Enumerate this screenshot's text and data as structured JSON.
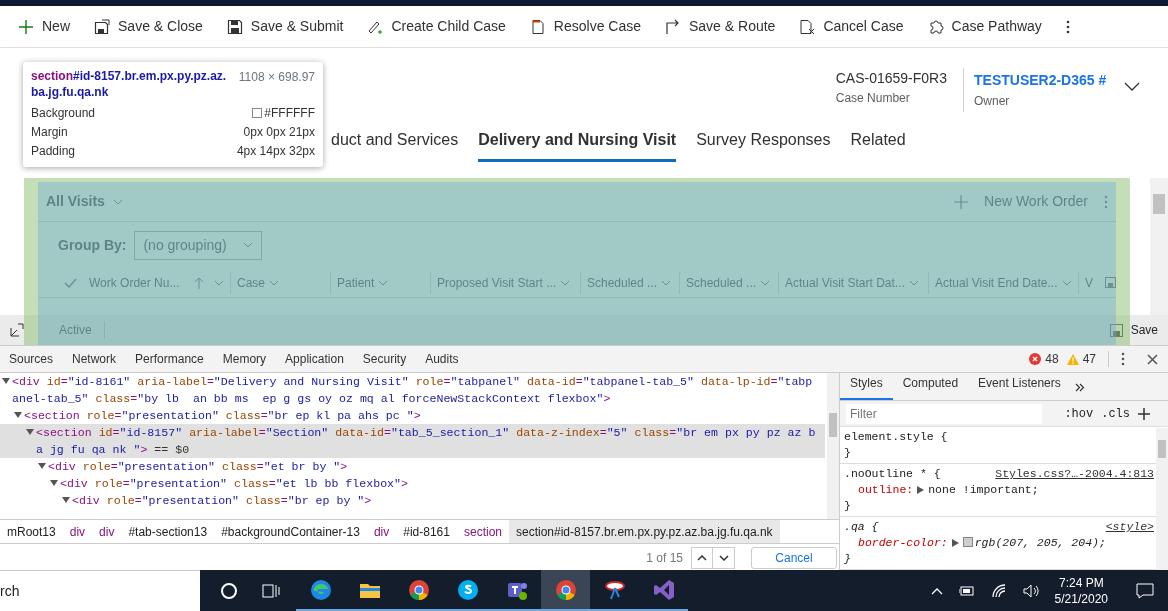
{
  "command_bar": [
    {
      "label": "New",
      "kind": "plus"
    },
    {
      "label": "Save & Close",
      "kind": "save-close"
    },
    {
      "label": "Save & Submit",
      "kind": "save"
    },
    {
      "label": "Create Child Case",
      "kind": "child"
    },
    {
      "label": "Resolve Case",
      "kind": "resolve"
    },
    {
      "label": "Save & Route",
      "kind": "route"
    },
    {
      "label": "Cancel Case",
      "kind": "cancel"
    },
    {
      "label": "Case Pathway",
      "kind": "puzzle"
    }
  ],
  "tooltip": {
    "tag": "section",
    "selector": "#id-8157.br.em.px.py.pz.az.ba.jg.fu.qa.nk",
    "size": "1108 × 698.97",
    "rows": [
      {
        "label": "Background",
        "value": "#FFFFFF",
        "swatch": true
      },
      {
        "label": "Margin",
        "value": "0px 0px 21px"
      },
      {
        "label": "Padding",
        "value": "4px 14px 32px"
      }
    ]
  },
  "record": {
    "number": "CAS-01659-F0R3",
    "number_label": "Case Number",
    "owner": "TESTUSER2-D365 #",
    "owner_label": "Owner"
  },
  "tabs": [
    {
      "label": "duct and Services",
      "selected": false
    },
    {
      "label": "Delivery and Nursing Visit",
      "selected": true
    },
    {
      "label": "Survey Responses",
      "selected": false
    },
    {
      "label": "Related",
      "selected": false
    }
  ],
  "grid": {
    "view": "All Visits",
    "new_button": "New Work Order",
    "group_by_label": "Group By:",
    "group_by_value": "(no grouping)",
    "columns": [
      {
        "label": "Work Order Nu...",
        "sorted": true
      },
      {
        "label": "Case",
        "sorted": false
      },
      {
        "label": "Patient",
        "sorted": false
      },
      {
        "label": "Proposed Visit Start ...",
        "sorted": false
      },
      {
        "label": "Scheduled ...",
        "sorted": false
      },
      {
        "label": "Scheduled ...",
        "sorted": false
      },
      {
        "label": "Actual Visit Start Dat...",
        "sorted": false
      },
      {
        "label": "Actual Visit End Date...",
        "sorted": false
      },
      {
        "label": "V",
        "sorted": false
      }
    ],
    "status": "Active",
    "save": "Save"
  },
  "devtools": {
    "tabs": [
      {
        "label": "Sources",
        "selected": false
      },
      {
        "label": "Network",
        "selected": false
      },
      {
        "label": "Performance",
        "selected": false
      },
      {
        "label": "Memory",
        "selected": false
      },
      {
        "label": "Application",
        "selected": false
      },
      {
        "label": "Security",
        "selected": false
      },
      {
        "label": "Audits",
        "selected": false
      }
    ],
    "errors": "48",
    "warnings": "47",
    "dom": [
      {
        "text": "<div id=\"id-8161\" aria-label=\"Delivery and Nursing Visit\" role=\"tabpanel\" data-id=\"tabpanel-tab_5\" data-lp-id=\"tabpanel-tab_5\" class=\"by lb  an bb ms  ep g gs oy oz mq al forceNewStackContext flexbox\">",
        "expanded": true,
        "selected": false,
        "children": [
          {
            "text": "<section role=\"presentation\" class=\"br ep kl pa ahs pc \">",
            "expanded": true,
            "selected": false,
            "children": [
              {
                "text": "<section id=\"id-8157\" aria-label=\"Section\" data-id=\"tab_5_section_1\" data-z-index=\"5\" class=\"br em px py pz az ba jg fu qa nk \">",
                "suffix": " == $0",
                "expanded": true,
                "selected": true,
                "children": [
                  {
                    "text": "<div role=\"presentation\" class=\"et br by \">",
                    "expanded": true,
                    "selected": false,
                    "children": [
                      {
                        "text": "<div role=\"presentation\" class=\"et lb bb flexbox\">",
                        "expanded": true,
                        "selected": false,
                        "children": [
                          {
                            "text": "<div role=\"presentation\" class=\"br ep by \">",
                            "expanded": true,
                            "selected": false
                          }
                        ]
                      }
                    ]
                  }
                ]
              }
            ]
          }
        ]
      }
    ],
    "breadcrumbs": [
      {
        "label": "mRoot13",
        "kind": "id",
        "selected": false
      },
      {
        "label": "div",
        "kind": "tag",
        "selected": false
      },
      {
        "label": "div",
        "kind": "tag",
        "selected": false
      },
      {
        "label": "#tab-section13",
        "kind": "id",
        "selected": false
      },
      {
        "label": "#backgroundContainer-13",
        "kind": "id",
        "selected": false
      },
      {
        "label": "div",
        "kind": "tag",
        "selected": false
      },
      {
        "label": "#id-8161",
        "kind": "id",
        "selected": false
      },
      {
        "label": "section",
        "kind": "tag",
        "selected": false
      },
      {
        "label": "section#id-8157.br.em.px.py.pz.az.ba.jg.fu.qa.nk",
        "kind": "id",
        "selected": true
      }
    ],
    "search": {
      "count": "1 of 15",
      "cancel": "Cancel"
    }
  },
  "styles_panel": {
    "tabs": [
      {
        "label": "Styles",
        "selected": true
      },
      {
        "label": "Computed",
        "selected": false
      },
      {
        "label": "Event Listeners",
        "selected": false
      }
    ],
    "filter_placeholder": "Filter",
    "hov": ":hov",
    "cls": ".cls",
    "rules": [
      {
        "selector": "element.style {",
        "close": "}",
        "italic": false
      },
      {
        "selector": ".noOutline * {",
        "source": "Styles.css?…-2004.4:813",
        "close": "}",
        "italic": false,
        "declarations": [
          {
            "property": "outline:",
            "value": "none !important;",
            "swatch": false
          }
        ]
      },
      {
        "selector": ".qa {",
        "source": "<style>",
        "close": "}",
        "italic": true,
        "declarations": [
          {
            "property": "border-color:",
            "value": "rgb(207, 205, 204);",
            "swatch": true
          }
        ]
      }
    ]
  },
  "taskbar": {
    "search": "rch",
    "apps": [
      {
        "kind": "edge",
        "active": false
      },
      {
        "kind": "folder",
        "active": false
      },
      {
        "kind": "chrome",
        "active": false
      },
      {
        "kind": "skype",
        "active": false
      },
      {
        "kind": "teams",
        "active": false
      },
      {
        "kind": "chrome",
        "active": true
      },
      {
        "kind": "tool",
        "active": false
      },
      {
        "kind": "studio",
        "active": false
      }
    ],
    "time": "7:24 PM",
    "date": "5/21/2020"
  }
}
